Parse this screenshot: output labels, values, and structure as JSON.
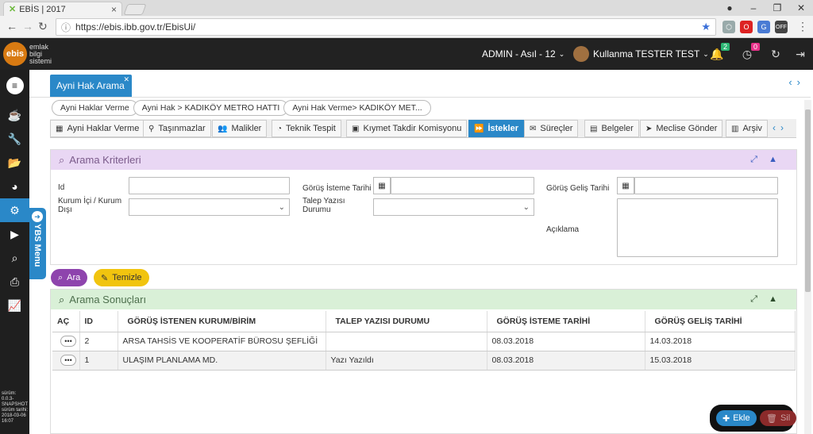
{
  "browser": {
    "tab_title": "EBİS | 2017",
    "url": "https://ebis.ibb.gov.tr/EbisUi/",
    "ext_off": "OFF"
  },
  "topbar": {
    "logo_mark": "ebis",
    "logo_line1": "emlak",
    "logo_line2": "bilgi",
    "logo_line3": "sistemi",
    "role": "ADMIN - Asıl - 12",
    "user": "Kullanma TESTER TEST",
    "notif_count": "2",
    "alert_count": "0"
  },
  "sidebar": {
    "ysb_label": "YBS Menu",
    "version_lines": [
      "sürüm:",
      "0.0.3-",
      "SNAPSHOT",
      "sürüm tarihi:",
      "2018-03-06",
      "16:07"
    ]
  },
  "page": {
    "tab_title": "Ayni Hak Arama",
    "breadcrumbs": [
      "Ayni Haklar Verme",
      "Ayni Hak > KADIKÖY METRO HATTI",
      "Ayni Hak Verme> KADIKÖY MET..."
    ],
    "tabs": [
      {
        "label": "Ayni Haklar Verme",
        "icon": "calendar-icon"
      },
      {
        "label": "Taşınmazlar",
        "icon": "map-marker-icon"
      },
      {
        "label": "Malikler",
        "icon": "users-icon"
      },
      {
        "label": "Teknik Tespit",
        "icon": "pie-chart-icon"
      },
      {
        "label": "Kıymet Takdir Komisyonu",
        "icon": "money-icon"
      },
      {
        "label": "İstekler",
        "icon": "forward-icon"
      },
      {
        "label": "Süreçler",
        "icon": "envelope-icon"
      },
      {
        "label": "Belgeler",
        "icon": "file-icon"
      },
      {
        "label": "Meclise Gönder",
        "icon": "send-icon"
      },
      {
        "label": "Arşiv",
        "icon": "archive-icon"
      }
    ]
  },
  "search": {
    "title": "Arama Kriterleri",
    "id_label": "Id",
    "kurum_label_1": "Kurum İçi / Kurum",
    "kurum_label_2": "Dışı",
    "istem_label": "Görüş İsteme Tarihi",
    "talep_label_1": "Talep Yazısı",
    "talep_label_2": "Durumu",
    "gelis_label": "Görüş Geliş Tarihi",
    "aciklama_label": "Açıklama",
    "search_button": "Ara",
    "clear_button": "Temizle"
  },
  "results": {
    "title": "Arama Sonuçları",
    "columns": [
      "AÇ",
      "ID",
      "GÖRÜŞ İSTENEN KURUM/BİRİM",
      "TALEP YAZISI DURUMU",
      "GÖRÜŞ İSTEME TARİHİ",
      "GÖRÜŞ GELİŞ TARİHİ"
    ],
    "rows": [
      {
        "id": "2",
        "kurum": "ARSA TAHSİS VE KOOPERATİF BÜROSU ŞEFLİĞİ",
        "durum": "",
        "istem": "08.03.2018",
        "gelis": "14.03.2018"
      },
      {
        "id": "1",
        "kurum": "ULAŞIM PLANLAMA MD.",
        "durum": "Yazı Yazıldı",
        "istem": "08.03.2018",
        "gelis": "15.03.2018"
      }
    ]
  },
  "actions": {
    "add": "Ekle",
    "delete": "Sil"
  },
  "colors": {
    "accent": "#2a88c8",
    "search_header": "#e9d7f4",
    "results_header": "#d9f0d7",
    "search_button": "#8e44ad",
    "clear_button": "#f1c40f",
    "add_button": "#2a88c8",
    "delete_button": "#8b2a2a"
  }
}
